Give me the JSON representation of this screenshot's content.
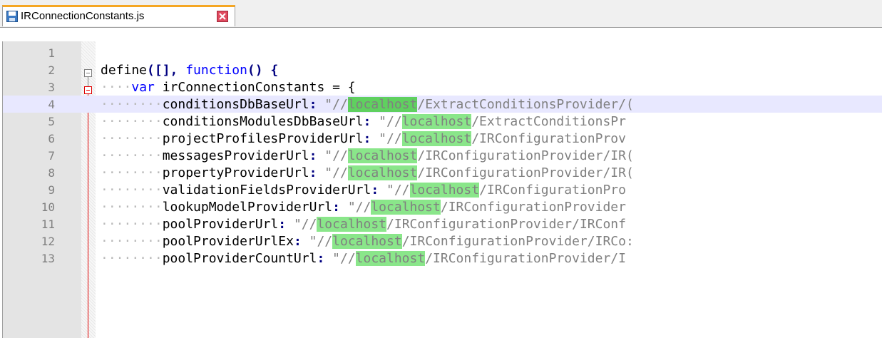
{
  "tab": {
    "title": "IRConnectionConstants.js",
    "save_icon": "save-icon",
    "close_icon": "close-icon"
  },
  "editor": {
    "lines": [
      {
        "num": "1"
      },
      {
        "num": "2"
      },
      {
        "num": "3"
      },
      {
        "num": "4"
      },
      {
        "num": "5"
      },
      {
        "num": "6"
      },
      {
        "num": "7"
      },
      {
        "num": "8"
      },
      {
        "num": "9"
      },
      {
        "num": "10"
      },
      {
        "num": "11"
      },
      {
        "num": "12"
      },
      {
        "num": "13"
      }
    ],
    "line2": {
      "a": "define",
      "b": "([], ",
      "kw": "function",
      "c": "() {"
    },
    "line3": {
      "kw": "var",
      "c": " irConnectionConstants = {"
    },
    "props": [
      {
        "key": "conditionsDbBaseUrl",
        "pre": "\"//",
        "host": "localhost",
        "post": "/ExtractConditionsProvider/("
      },
      {
        "key": "conditionsModulesDbBaseUrl",
        "pre": "\"//",
        "host": "localhost",
        "post": "/ExtractConditionsPr"
      },
      {
        "key": "projectProfilesProviderUrl",
        "pre": "\"//",
        "host": "localhost",
        "post": "/IRConfigurationProv"
      },
      {
        "key": "messagesProviderUrl",
        "pre": "\"//",
        "host": "localhost",
        "post": "/IRConfigurationProvider/IR("
      },
      {
        "key": "propertyProviderUrl",
        "pre": "\"//",
        "host": "localhost",
        "post": "/IRConfigurationProvider/IR("
      },
      {
        "key": "validationFieldsProviderUrl",
        "pre": "\"//",
        "host": "localhost",
        "post": "/IRConfigurationPro"
      },
      {
        "key": "lookupModelProviderUrl",
        "pre": "\"//",
        "host": "localhost",
        "post": "/IRConfigurationProvider"
      },
      {
        "key": "poolProviderUrl",
        "pre": "\"//",
        "host": "localhost",
        "post": "/IRConfigurationProvider/IRConf"
      },
      {
        "key": "poolProviderUrlEx",
        "pre": "\"//",
        "host": "localhost",
        "post": "/IRConfigurationProvider/IRCo:"
      },
      {
        "key": "poolProviderCountUrl",
        "pre": "\"//",
        "host": "localhost",
        "post": "/IRConfigurationProvider/I"
      }
    ]
  },
  "colors": {
    "highlight": "#8ae68a",
    "highlight_current": "#5fd05f",
    "keyword": "#0000ff",
    "fold_marker": "#e00000",
    "tab_accent": "#f5a623"
  }
}
